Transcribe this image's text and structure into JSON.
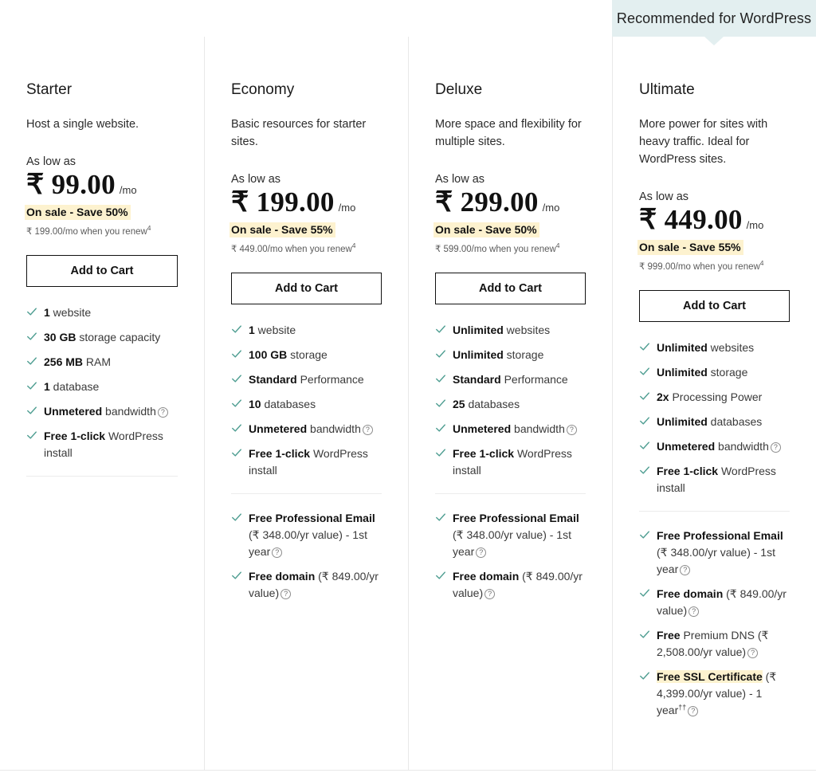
{
  "badge": {
    "label": "Recommended for WordPress",
    "bg_color": "#e3eff0",
    "applies_to_plan": "Ultimate"
  },
  "labels": {
    "as_low_as": "As low as",
    "per_month": "/mo",
    "add_to_cart": "Add to Cart",
    "help_icon": "?"
  },
  "accent_colors": {
    "check": "#4f9e92",
    "sale_highlight": "#fdf2cf",
    "button_border": "#111111",
    "column_divider": "#e8e8e8"
  },
  "plans": [
    {
      "name": "Starter",
      "description": "Host a single website.",
      "as_low_as": "As low as",
      "price": "₹ 99.00",
      "per": "/mo",
      "sale": "On sale - Save 50%",
      "renew": "₹ 199.00/mo when you renew",
      "renew_sup": "4",
      "cta": "Add to Cart",
      "features": [
        {
          "bold": "1",
          "rest": " website",
          "help": false
        },
        {
          "bold": "30 GB",
          "rest": " storage capacity",
          "help": false
        },
        {
          "bold": "256 MB",
          "rest": " RAM",
          "help": false
        },
        {
          "bold": "1",
          "rest": " database",
          "help": false
        },
        {
          "bold": "Unmetered",
          "rest": " bandwidth",
          "help": true
        },
        {
          "bold": "Free 1-click",
          "rest": " WordPress install",
          "help": false
        }
      ],
      "has_divider": true,
      "extra_features": []
    },
    {
      "name": "Economy",
      "description": "Basic resources for starter sites.",
      "as_low_as": "As low as",
      "price": "₹ 199.00",
      "per": "/mo",
      "sale": "On sale - Save 55%",
      "renew": "₹ 449.00/mo when you renew",
      "renew_sup": "4",
      "cta": "Add to Cart",
      "features": [
        {
          "bold": "1",
          "rest": " website",
          "help": false
        },
        {
          "bold": "100 GB",
          "rest": " storage",
          "help": false
        },
        {
          "bold": "Standard",
          "rest": " Performance",
          "help": false
        },
        {
          "bold": "10",
          "rest": " databases",
          "help": false
        },
        {
          "bold": "Unmetered",
          "rest": " bandwidth",
          "help": true
        },
        {
          "bold": "Free 1-click",
          "rest": " WordPress install",
          "help": false
        }
      ],
      "has_divider": true,
      "extra_features": [
        {
          "bold": "Free Professional Email",
          "rest": " (₹ 348.00/yr value) - 1st year",
          "help": true
        },
        {
          "bold": "Free domain",
          "rest": " (₹ 849.00/yr value)",
          "help": true
        }
      ]
    },
    {
      "name": "Deluxe",
      "description": "More space and flexibility for multiple sites.",
      "as_low_as": "As low as",
      "price": "₹ 299.00",
      "per": "/mo",
      "sale": "On sale - Save 50%",
      "renew": "₹ 599.00/mo when you renew",
      "renew_sup": "4",
      "cta": "Add to Cart",
      "features": [
        {
          "bold": "Unlimited",
          "rest": " websites",
          "help": false
        },
        {
          "bold": "Unlimited",
          "rest": " storage",
          "help": false
        },
        {
          "bold": "Standard",
          "rest": " Performance",
          "help": false
        },
        {
          "bold": "25",
          "rest": " databases",
          "help": false
        },
        {
          "bold": "Unmetered",
          "rest": " bandwidth",
          "help": true
        },
        {
          "bold": "Free 1-click",
          "rest": " WordPress install",
          "help": false
        }
      ],
      "has_divider": true,
      "extra_features": [
        {
          "bold": "Free Professional Email",
          "rest": " (₹ 348.00/yr value) - 1st year",
          "help": true
        },
        {
          "bold": "Free domain",
          "rest": " (₹ 849.00/yr value)",
          "help": true
        }
      ]
    },
    {
      "name": "Ultimate",
      "description": "More power for sites with heavy traffic. Ideal for WordPress sites.",
      "as_low_as": "As low as",
      "price": "₹ 449.00",
      "per": "/mo",
      "sale": "On sale - Save 55%",
      "renew": "₹ 999.00/mo when you renew",
      "renew_sup": "4",
      "cta": "Add to Cart",
      "features": [
        {
          "bold": "Unlimited",
          "rest": " websites",
          "help": false
        },
        {
          "bold": "Unlimited",
          "rest": " storage",
          "help": false
        },
        {
          "bold": "2x",
          "rest": " Processing Power",
          "help": false
        },
        {
          "bold": "Unlimited",
          "rest": " databases",
          "help": false
        },
        {
          "bold": "Unmetered",
          "rest": " bandwidth",
          "help": true
        },
        {
          "bold": "Free 1-click",
          "rest": " WordPress install",
          "help": false
        }
      ],
      "has_divider": true,
      "extra_features": [
        {
          "bold": "Free Professional Email",
          "rest": " (₹ 348.00/yr value) - 1st year",
          "help": true
        },
        {
          "bold": "Free domain",
          "rest": " (₹ 849.00/yr value)",
          "help": true
        },
        {
          "bold": "Free",
          "rest": " Premium DNS (₹ 2,508.00/yr value)",
          "help": true
        },
        {
          "highlight": "Free SSL Certificate",
          "rest": " (₹ 4,399.00/yr value) - 1 year",
          "sup": "††",
          "help": true
        }
      ]
    }
  ]
}
